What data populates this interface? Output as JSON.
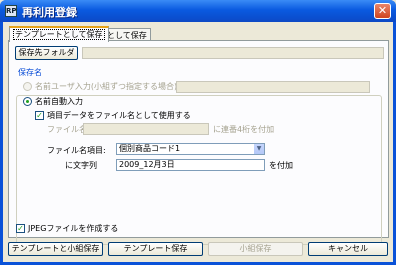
{
  "window": {
    "title": "再利用登録",
    "icon_text": "RP",
    "close_glyph": "✕"
  },
  "tabs": [
    {
      "label": "テンプレートとして保存"
    },
    {
      "label": "小組として保存"
    }
  ],
  "panel": {
    "save_folder_button": "保存先フォルダ",
    "save_folder_value": "",
    "group_title": "保存名",
    "radio_user_input": "名前ユーザ入力(小組ずつ指定する場合)",
    "user_input_value": "",
    "radio_auto_input": "名前自動入力",
    "check_use_item_data": "項目データをファイル名として使用する",
    "check_mark": "✓",
    "file_name_label": "ファイル名:",
    "file_name_value": "",
    "file_name_suffix": "に連番4桁を付加",
    "file_item_label": "ファイル名項目:",
    "file_item_selected": "個別商品コード1",
    "combo_arrow": "▼",
    "string_label": "に文字列",
    "string_value": "2009_12月3日",
    "string_suffix": "を付加",
    "jpeg_check_label": "JPEGファイルを作成する"
  },
  "footer": {
    "btn_template_and_small_save": "テンプレートと小組保存",
    "btn_template_save": "テンプレート保存",
    "btn_small_save": "小組保存",
    "btn_cancel": "キャンセル"
  }
}
